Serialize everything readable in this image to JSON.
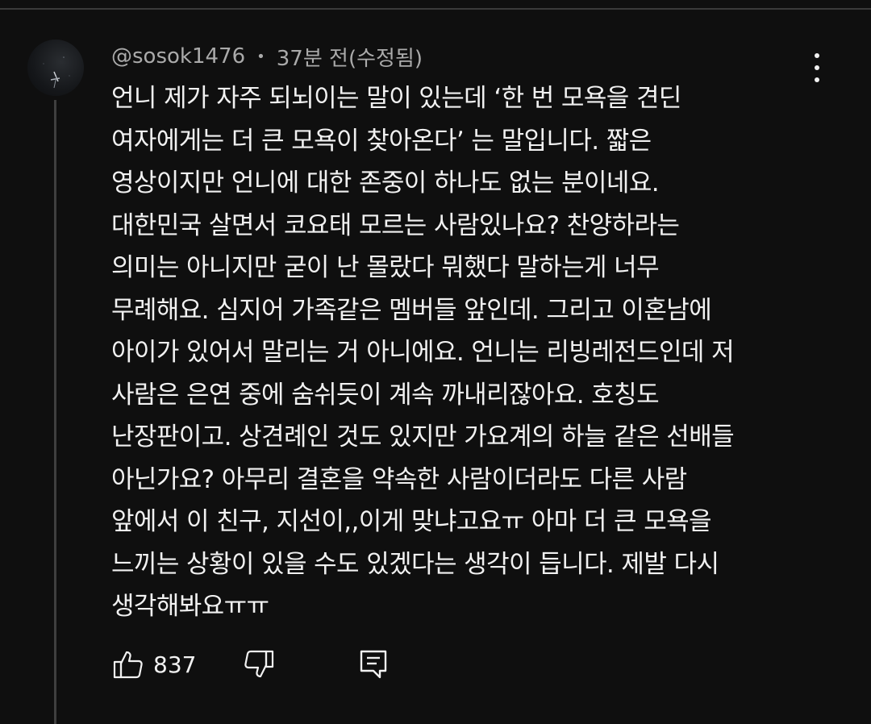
{
  "comment": {
    "author": "@sosok1476",
    "separator": "•",
    "time": "37분 전(수정됨)",
    "lines": [
      "언니 제가 자주 되뇌이는 말이 있는데 ‘한 번 모욕을 견딘",
      "여자에게는 더 큰 모욕이 찾아온다’ 는 말입니다. 짧은",
      "영상이지만 언니에 대한 존중이 하나도 없는 분이네요.",
      "대한민국 살면서 코요태 모르는 사람있나요? 찬양하라는",
      "의미는 아니지만 굳이 난 몰랐다 뭐했다 말하는게 너무",
      "무례해요. 심지어 가족같은 멤버들 앞인데. 그리고 이혼남에",
      "아이가 있어서 말리는 거 아니에요. 언니는 리빙레전드인데 저",
      "사람은 은연 중에 숨쉬듯이 계속 까내리잖아요. 호칭도",
      "난장판이고. 상견례인 것도 있지만 가요계의 하늘 같은 선배들",
      "아닌가요? 아무리 결혼을 약속한 사람이더라도 다른 사람",
      "앞에서 이 친구, 지선이,,이게 맞냐고요ㅠ 아마 더 큰 모욕을",
      "느끼는 상황이 있을 수도 있겠다는 생각이 듭니다. 제발 다시",
      "생각해봐요ㅠㅠ"
    ],
    "like_count": "837"
  },
  "icons": {
    "avatar": "avatar-image",
    "more": "more-vertical-icon",
    "like": "thumbs-up-icon",
    "dislike": "thumbs-down-icon",
    "reply": "reply-comment-icon"
  },
  "colors": {
    "background": "#0f0f0f",
    "text_primary": "#f1f1f1",
    "text_secondary": "#aaaaaa",
    "thread_line": "#3f3f3f"
  }
}
